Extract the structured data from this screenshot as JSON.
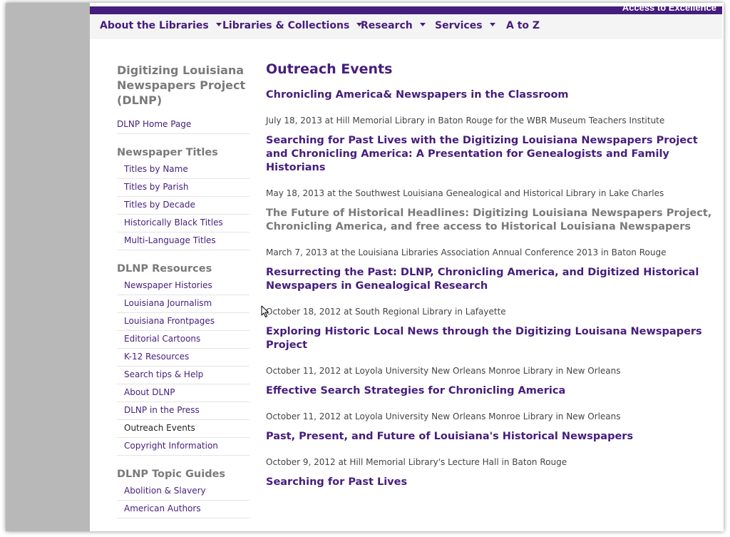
{
  "header": {
    "tagline": "Access to Excellence"
  },
  "nav": [
    {
      "label": "About the Libraries",
      "has_menu": true
    },
    {
      "label": "Libraries & Collections",
      "has_menu": true
    },
    {
      "label": "Research",
      "has_menu": true
    },
    {
      "label": "Services",
      "has_menu": true
    },
    {
      "label": "A to Z",
      "has_menu": false
    }
  ],
  "sidebar": {
    "title": "Digitizing Louisiana Newspapers Project (DLNP)",
    "home_link": "DLNP Home Page",
    "sections": [
      {
        "heading": "Newspaper Titles",
        "items": [
          "Titles by Name",
          "Titles by Parish",
          "Titles by Decade",
          "Historically Black Titles",
          "Multi-Language Titles"
        ]
      },
      {
        "heading": "DLNP Resources",
        "items": [
          "Newspaper Histories",
          "Louisiana Journalism",
          "Louisiana Frontpages",
          "Editorial Cartoons",
          "K-12 Resources",
          "Search tips & Help",
          "About DLNP",
          "DLNP in the Press",
          "Outreach Events",
          "Copyright Information"
        ]
      },
      {
        "heading": "DLNP Topic Guides",
        "items": [
          "Abolition & Slavery",
          "American Authors"
        ]
      }
    ],
    "current_item": "Outreach Events"
  },
  "main": {
    "title": "Outreach Events",
    "events": [
      {
        "title": "Chronicling America& Newspapers in the Classroom",
        "desc": "July 18, 2013 at Hill Memorial Library in Baton Rouge for the WBR Museum Teachers Institute",
        "linked": true
      },
      {
        "title": "Searching for Past Lives with the Digitizing Louisiana Newspapers Project and Chronicling America: A Presentation for Genealogists and Family Historians",
        "desc": "May 18, 2013 at the Southwest Louisiana Genealogical and Historical Library in Lake Charles",
        "linked": true
      },
      {
        "title": "The Future of Historical Headlines: Digitizing Louisiana Newspapers Project, Chronicling America, and free access to Historical Louisiana Newspapers",
        "desc": "March 7, 2013 at the Louisiana Libraries Association Annual Conference 2013 in Baton Rouge",
        "linked": false
      },
      {
        "title": "Resurrecting the Past: DLNP, Chronicling America, and Digitized Historical Newspapers in Genealogical Research",
        "desc": "October 18, 2012 at South Regional Library in Lafayette",
        "linked": true
      },
      {
        "title": "Exploring Historic Local News through the Digitizing Louisana Newspapers Project",
        "desc": "October 11, 2012 at Loyola University New Orleans Monroe Library in New Orleans",
        "linked": true
      },
      {
        "title": "Effective Search Strategies for Chronicling America",
        "desc": "October 11, 2012 at Loyola University New Orleans Monroe Library in New Orleans",
        "linked": true
      },
      {
        "title": "Past, Present, and Future of Louisiana's Historical Newspapers",
        "desc": "October 9, 2012 at Hill Memorial Library's Lecture Hall in Baton Rouge",
        "linked": true
      },
      {
        "title": "Searching for Past Lives",
        "desc": "",
        "linked": true
      }
    ]
  },
  "colors": {
    "brand_purple": "#461d7c",
    "gray_heading": "#7a7a7a"
  },
  "icons": {
    "cursor": "mouse-pointer-icon",
    "dropdown": "caret-down-icon"
  }
}
